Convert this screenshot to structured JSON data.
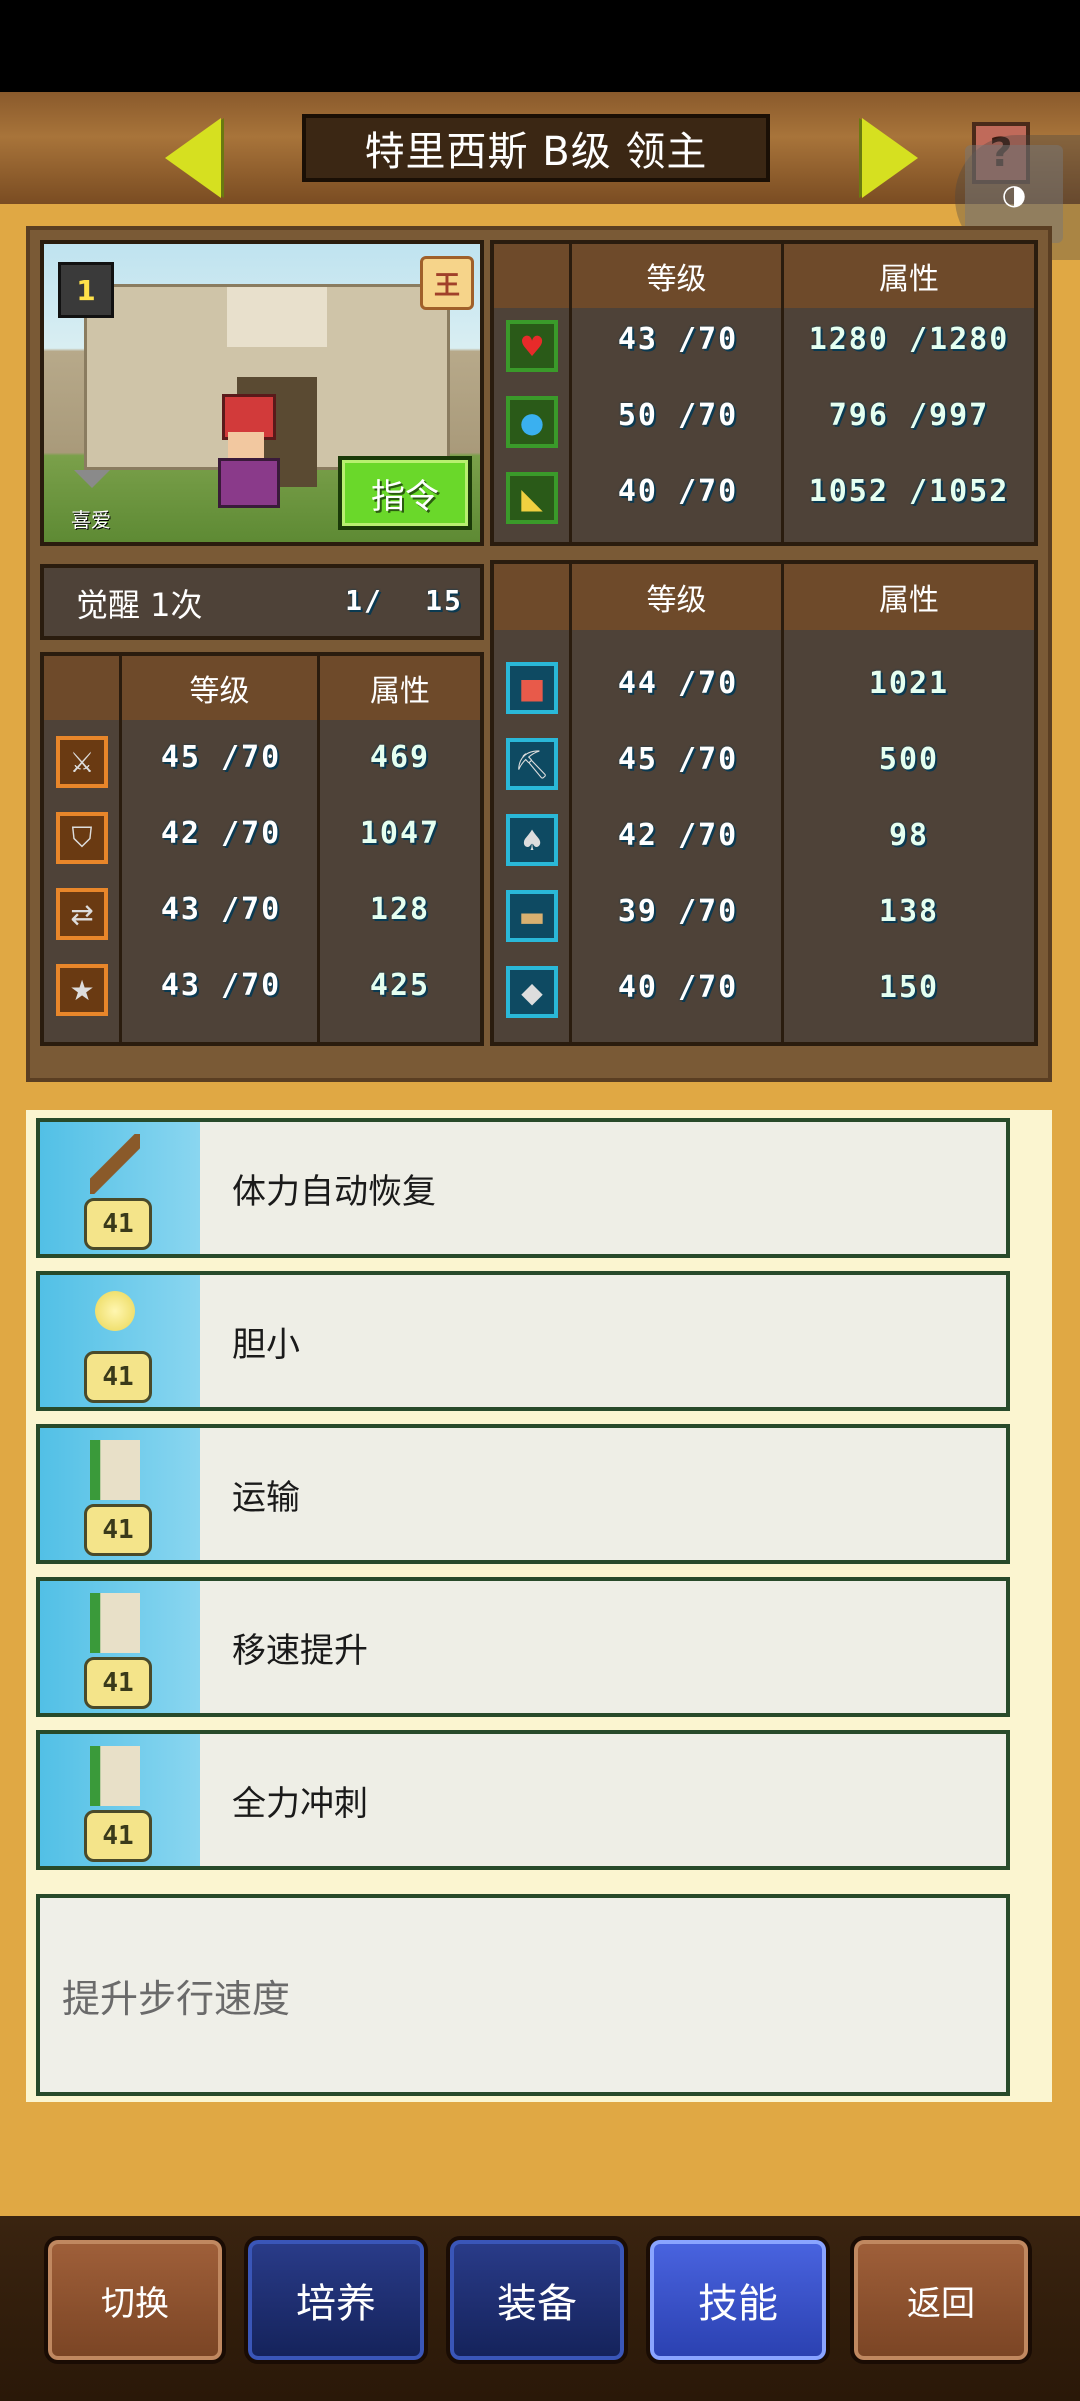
{
  "header": {
    "title": "特里西斯 B级 领主",
    "help_icon": "?"
  },
  "portrait": {
    "level_badge": "1",
    "rank_badge": "王",
    "favorite_label": "喜爱",
    "command_button": "指令"
  },
  "main_stats": {
    "headers": [
      "等级",
      "属性"
    ],
    "rows": [
      {
        "icon": "heart-icon",
        "level": "43 /70",
        "value": "1280 /1280"
      },
      {
        "icon": "potion-icon",
        "level": "50 /70",
        "value": "796 /997"
      },
      {
        "icon": "arm-icon",
        "level": "40 /70",
        "value": "1052 /1052"
      }
    ]
  },
  "awaken": {
    "label": "觉醒 1次",
    "count": "1/",
    "max": "15"
  },
  "combat_stats": {
    "headers": [
      "等级",
      "属性"
    ],
    "rows": [
      {
        "icon": "sword-icon",
        "level": "45 /70",
        "value": "469"
      },
      {
        "icon": "shield-icon",
        "level": "42 /70",
        "value": "1047"
      },
      {
        "icon": "arrows-icon",
        "level": "43 /70",
        "value": "128"
      },
      {
        "icon": "star-icon",
        "level": "43 /70",
        "value": "425"
      }
    ]
  },
  "work_stats": {
    "headers": [
      "等级",
      "属性"
    ],
    "rows": [
      {
        "icon": "book-icon",
        "level": "44 /70",
        "value": "1021"
      },
      {
        "icon": "pickaxe-icon",
        "level": "45 /70",
        "value": "500"
      },
      {
        "icon": "shovel-icon",
        "level": "42 /70",
        "value": "98"
      },
      {
        "icon": "chest-icon",
        "level": "39 /70",
        "value": "138"
      },
      {
        "icon": "axe-icon",
        "level": "40 /70",
        "value": "150"
      }
    ]
  },
  "skills": [
    {
      "name": "体力自动恢复",
      "level": "41",
      "icon": "wand-icon"
    },
    {
      "name": "胆小",
      "level": "41",
      "icon": "lightbulb-icon"
    },
    {
      "name": "运输",
      "level": "41",
      "icon": "scroll-icon"
    },
    {
      "name": "移速提升",
      "level": "41",
      "icon": "scroll-icon"
    },
    {
      "name": "全力冲刺",
      "level": "41",
      "icon": "scroll-icon"
    }
  ],
  "description": "提升步行速度",
  "nav": {
    "switch": "切换",
    "train": "培养",
    "equip": "装备",
    "skill": "技能",
    "back": "返回"
  }
}
